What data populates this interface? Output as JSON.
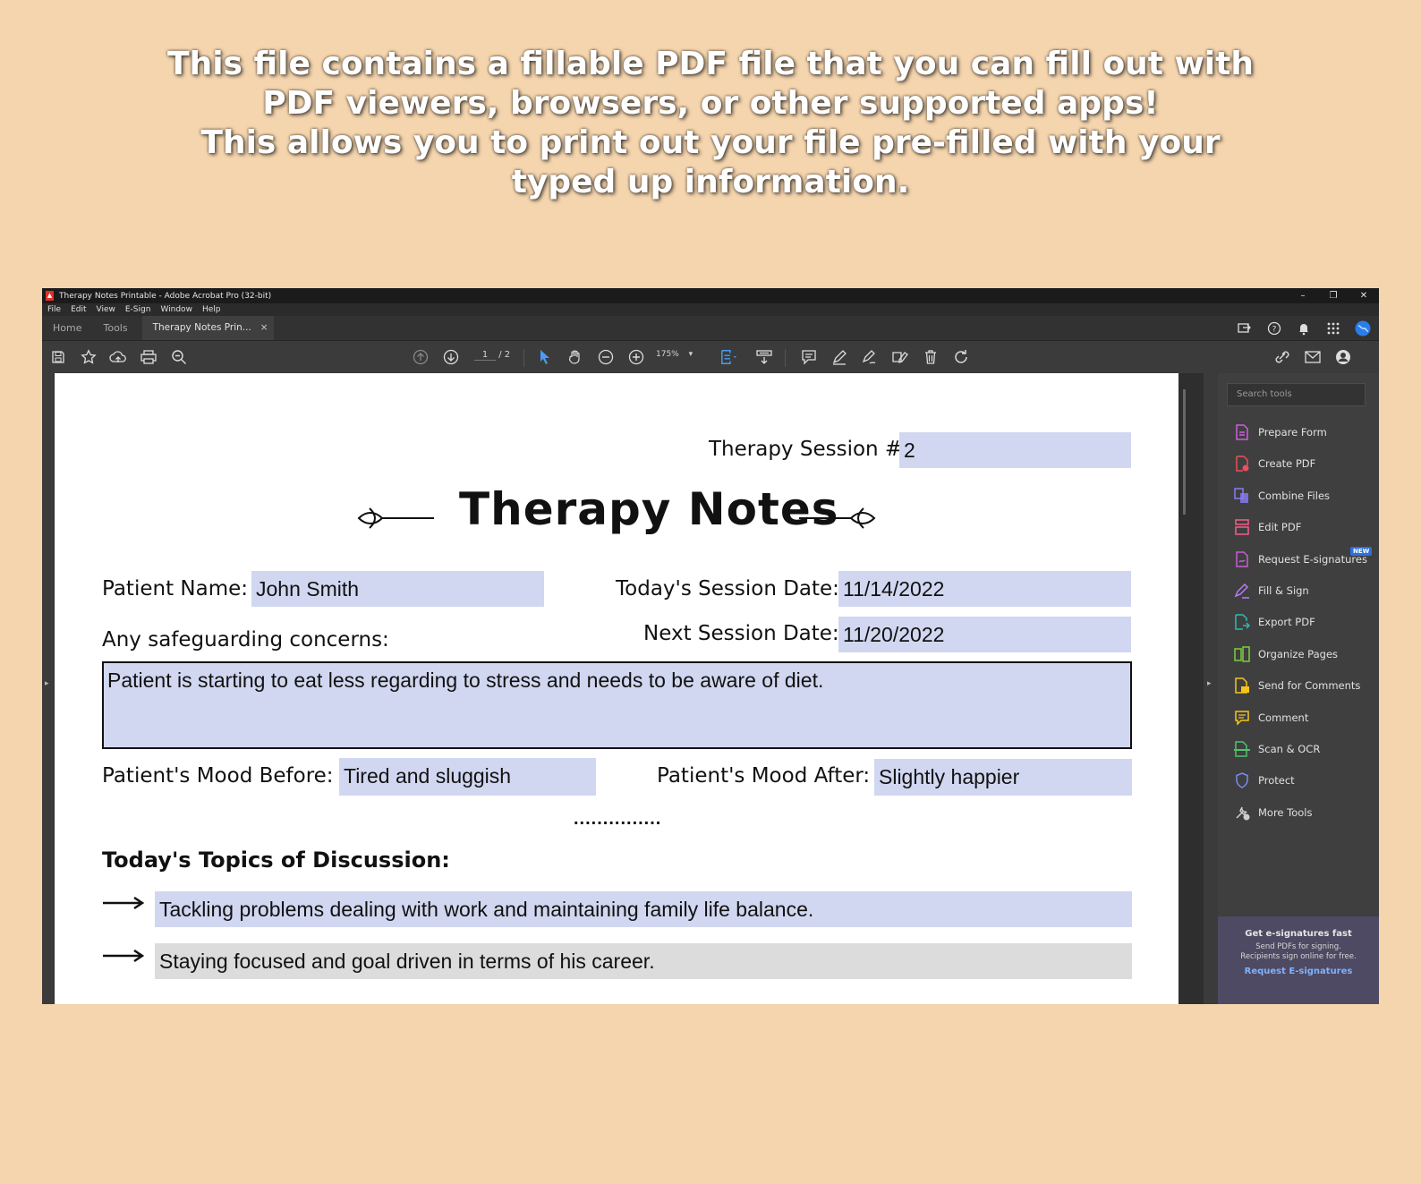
{
  "banner": {
    "lines": [
      "This file contains a fillable PDF file that you can fill out with",
      "PDF viewers, browsers, or other supported apps!",
      "This allows you to print out your file pre-filled with your",
      "typed up information."
    ]
  },
  "window": {
    "title": "Therapy Notes Printable - Adobe Acrobat Pro (32-bit)",
    "controls": {
      "minimize": "–",
      "restore": "❐",
      "close": "✕"
    }
  },
  "menu": [
    "File",
    "Edit",
    "View",
    "E-Sign",
    "Window",
    "Help"
  ],
  "tabs": {
    "home": "Home",
    "tools": "Tools",
    "document": "Therapy Notes Prin...",
    "close": "×"
  },
  "toolbar": {
    "page_current": "1",
    "page_total": "/ 2",
    "zoom": "175%"
  },
  "document": {
    "session_label": "Therapy Session #",
    "session_value": "2",
    "title": "Therapy Notes",
    "patient_name_label": "Patient Name:",
    "patient_name_value": "John Smith",
    "session_date_label": "Today's Session Date:",
    "session_date_value": "11/14/2022",
    "next_date_label": "Next Session Date:",
    "next_date_value": "11/20/2022",
    "safeguarding_label": "Any safeguarding concerns:",
    "safeguarding_value": "Patient is starting to eat less regarding to stress and needs to be aware of diet.",
    "mood_before_label": "Patient's Mood Before:",
    "mood_before_value": "Tired and sluggish",
    "mood_after_label": "Patient's Mood After:",
    "mood_after_value": "Slightly happier",
    "separator": "...............",
    "topics_heading": "Today's Topics of Discussion:",
    "topics": [
      "Tackling problems dealing with work and maintaining family life balance.",
      "Staying focused and goal driven in terms of his career."
    ]
  },
  "tools_panel": {
    "search_placeholder": "Search tools",
    "items": [
      {
        "label": "Prepare Form",
        "icon": "prepare-form-icon",
        "color": "#d05ce3"
      },
      {
        "label": "Create PDF",
        "icon": "create-pdf-icon",
        "color": "#e8505b"
      },
      {
        "label": "Combine Files",
        "icon": "combine-files-icon",
        "color": "#8a7cf7"
      },
      {
        "label": "Edit PDF",
        "icon": "edit-pdf-icon",
        "color": "#f25f8a"
      },
      {
        "label": "Request E-signatures",
        "icon": "request-esign-icon",
        "color": "#c75fd6"
      },
      {
        "label": "Fill & Sign",
        "icon": "fill-sign-icon",
        "color": "#b77cf5"
      },
      {
        "label": "Export PDF",
        "icon": "export-pdf-icon",
        "color": "#2fb9b0"
      },
      {
        "label": "Organize Pages",
        "icon": "organize-pages-icon",
        "color": "#7ccf3d"
      },
      {
        "label": "Send for Comments",
        "icon": "send-comments-icon",
        "color": "#f5c518"
      },
      {
        "label": "Comment",
        "icon": "comment-icon",
        "color": "#f5c518"
      },
      {
        "label": "Scan & OCR",
        "icon": "scan-ocr-icon",
        "color": "#4cc56a"
      },
      {
        "label": "Protect",
        "icon": "protect-icon",
        "color": "#7b8cf5"
      },
      {
        "label": "More Tools",
        "icon": "more-tools-icon",
        "color": "#cfcfcf"
      }
    ],
    "new_badge": "NEW",
    "promo": {
      "heading": "Get e-signatures fast",
      "line1": "Send PDFs for signing.",
      "line2": "Recipients sign online for free.",
      "link": "Request E-signatures"
    }
  },
  "colors": {
    "background": "#f5d5ae",
    "form_field": "#d1d7f0",
    "field_gray": "#dcdcdc",
    "app_dark": "#3b3b3b"
  }
}
